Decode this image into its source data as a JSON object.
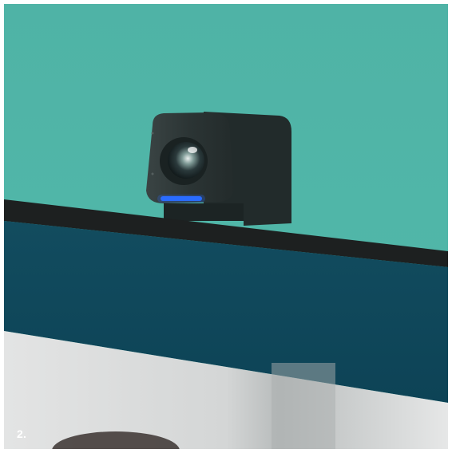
{
  "photo": {
    "subject": "webcam-on-monitor",
    "colors": {
      "wall": "#50b6a8",
      "monitor_bezel": "#0f4a5c",
      "camera_body": "#2b3434",
      "status_light": "#2a6cff",
      "screen": "#dcdcdc"
    }
  },
  "caption": {
    "step_number": "2."
  }
}
